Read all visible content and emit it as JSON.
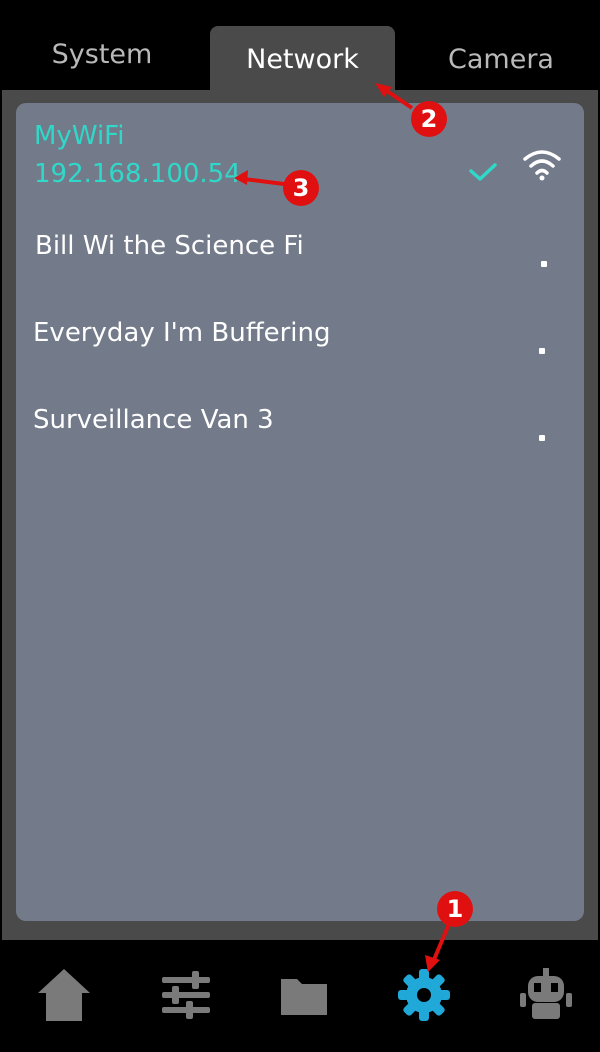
{
  "tabs": [
    {
      "label": "System",
      "active": false
    },
    {
      "label": "Network",
      "active": true
    },
    {
      "label": "Camera",
      "active": false
    }
  ],
  "networks": [
    {
      "ssid": "MyWiFi",
      "ip": "192.168.100.54",
      "connected": true,
      "status_icon": "check-icon",
      "signal_icon": "wifi-icon"
    },
    {
      "ssid": "Bill Wi the Science Fi",
      "connected": false,
      "signal_icon": "wifi-weak-dot-icon"
    },
    {
      "ssid": "Everyday I'm Buffering",
      "connected": false,
      "signal_icon": "wifi-weak-dot-icon"
    },
    {
      "ssid": "Surveillance Van 3",
      "connected": false,
      "signal_icon": "wifi-weak-dot-icon"
    }
  ],
  "bottom_nav": [
    {
      "icon": "home-icon",
      "active": false
    },
    {
      "icon": "sliders-icon",
      "active": false
    },
    {
      "icon": "folder-icon",
      "active": false
    },
    {
      "icon": "gear-icon",
      "active": true
    },
    {
      "icon": "robot-icon",
      "active": false
    }
  ],
  "annotations": [
    {
      "label": "1"
    },
    {
      "label": "2"
    },
    {
      "label": "3"
    }
  ],
  "colors": {
    "accent": "#2fd8c8",
    "panel": "#737b8b",
    "frame": "#4a4a4a",
    "active_nav": "#1fa8d8",
    "inactive_nav": "#7a7a7a",
    "annotation": "#e01010"
  }
}
